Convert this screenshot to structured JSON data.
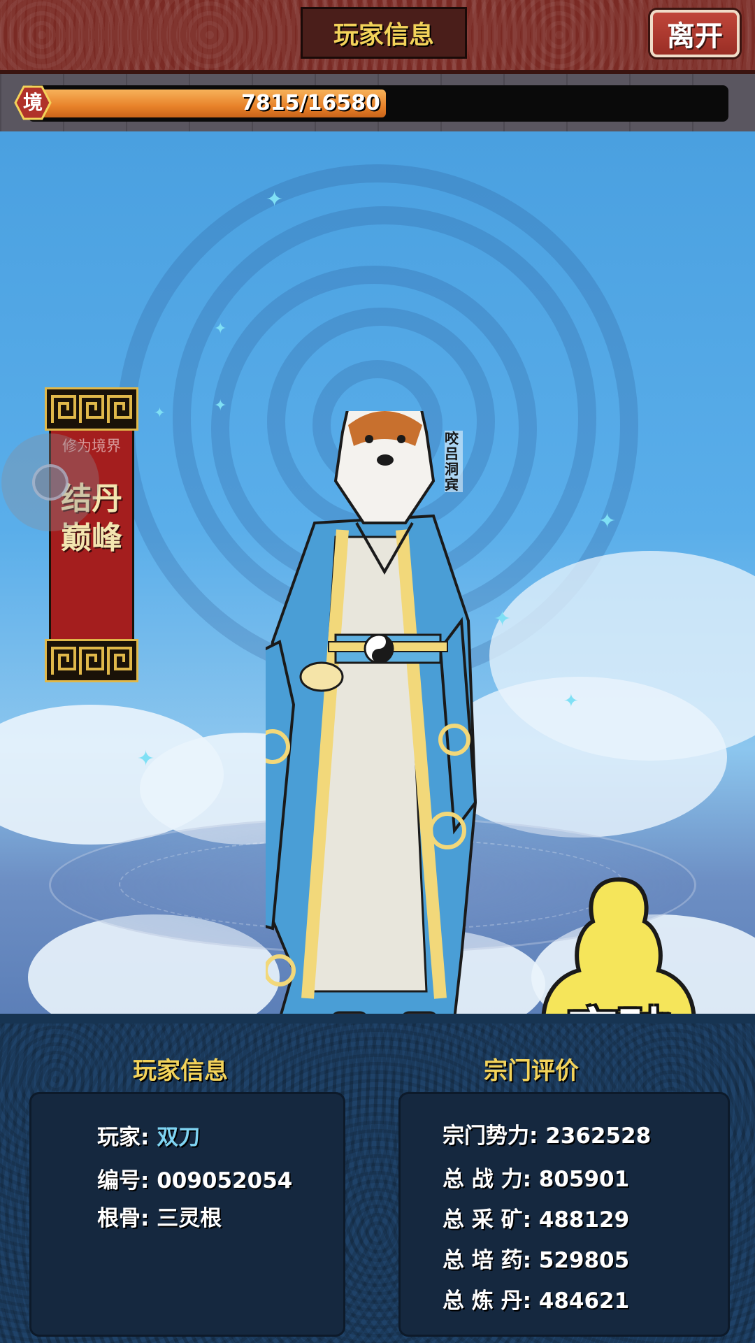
{
  "header": {
    "title": "玩家信息",
    "leave_label": "离开"
  },
  "cultivation_bar": {
    "badge": "境",
    "current": 7815,
    "max": 16580,
    "text": "7815/16580",
    "fraction": 0.471
  },
  "realm": {
    "label": "修为境界",
    "value": "结丹巅峰"
  },
  "npc_label": "咬吕洞宾",
  "breakthrough_label": "突破",
  "player_info": {
    "heading": "玩家信息",
    "player_label": "玩家:",
    "player_name": "双刀",
    "id_label": "编号:",
    "id_value": "009052054",
    "root_label": "根骨:",
    "root_value": "三灵根"
  },
  "sect_rating": {
    "heading": "宗门评价",
    "rows": [
      {
        "label": "宗门势力:",
        "value": "2362528"
      },
      {
        "label": "总 战 力:",
        "value": "805901"
      },
      {
        "label": "总 采 矿:",
        "value": "488129"
      },
      {
        "label": "总 培 药:",
        "value": "529805"
      },
      {
        "label": "总 炼 丹:",
        "value": "484621"
      }
    ]
  },
  "colors": {
    "top_bar": "#7a2a24",
    "title_text": "#f3d35a",
    "progress_fill": "#e8822a",
    "player_name": "#7fd4f2",
    "breakthrough_blob": "#f5e55a"
  },
  "icons": {
    "realm_badge": "red-hexagon-icon",
    "joystick": "virtual-joystick-icon",
    "breakthrough": "meditating-figure-icon"
  }
}
